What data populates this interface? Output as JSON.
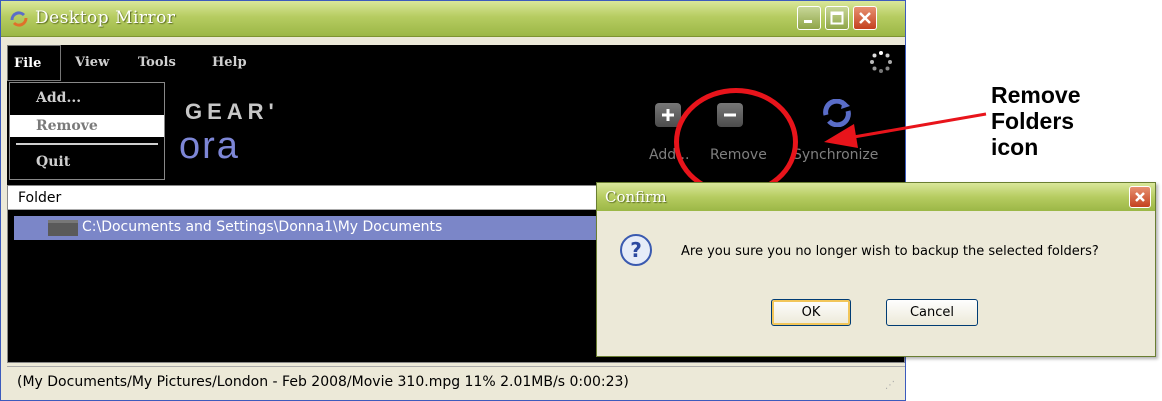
{
  "window": {
    "title": "Desktop Mirror"
  },
  "menu": {
    "file": "File",
    "view": "View",
    "tools": "Tools",
    "help": "Help"
  },
  "file_menu": {
    "add": "Add...",
    "remove": "Remove",
    "quit": "Quit"
  },
  "logo": {
    "top": "GEAR'",
    "bottom": "ora"
  },
  "toolbar": {
    "add": "Add...",
    "remove": "Remove",
    "synchronize": "Synchronize"
  },
  "folder_list": {
    "header": "Folder",
    "rows": [
      "C:\\Documents and Settings\\Donna1\\My Documents"
    ]
  },
  "status": "(My Documents/My Pictures/London - Feb 2008/Movie 310.mpg 11%   2.01MB/s   0:00:23)",
  "dialog": {
    "title": "Confirm",
    "message": "Are you sure you no longer wish to backup the selected folders?",
    "ok": "OK",
    "cancel": "Cancel"
  },
  "callout": {
    "line1": "Remove",
    "line2": "Folders",
    "line3": "icon"
  },
  "colors": {
    "accent_red": "#e8141b",
    "title_green": "#b6cc61",
    "selection": "#7b86c8"
  }
}
